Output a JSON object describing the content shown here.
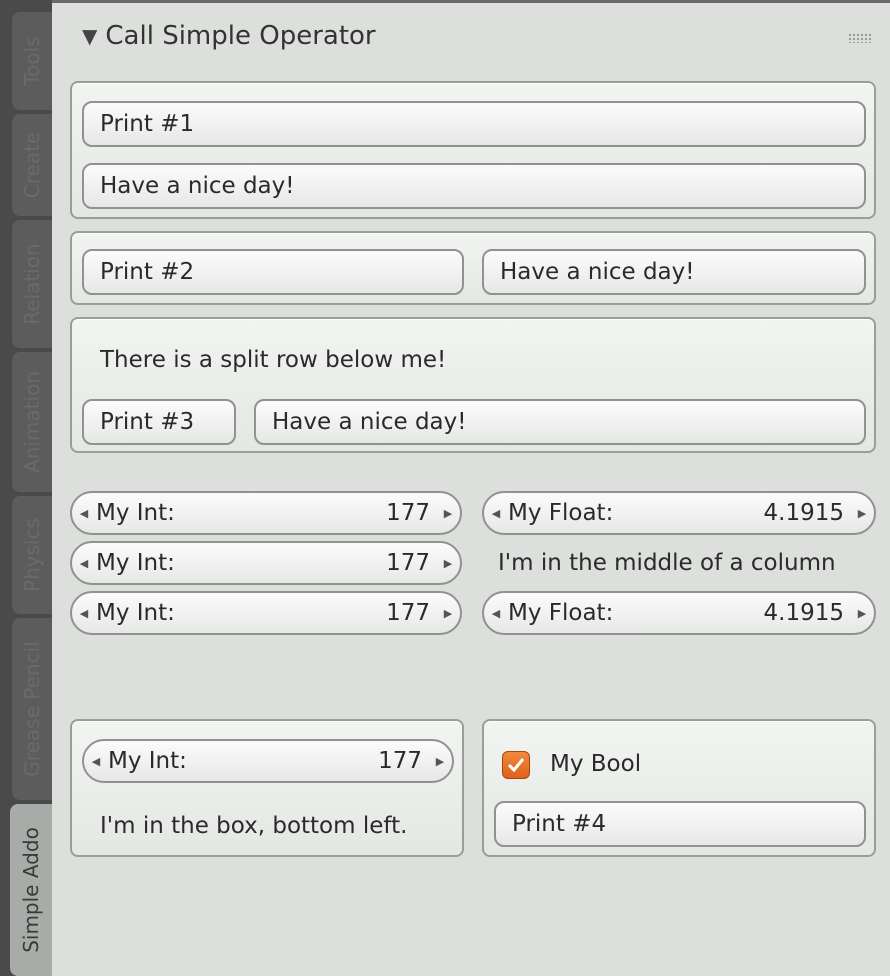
{
  "tabs": [
    "Tools",
    "Create",
    "Relation",
    "Animation",
    "Physics",
    "Grease Pencil",
    "Simple Addo"
  ],
  "panel": {
    "title": "Call Simple Operator"
  },
  "box1": {
    "button": "Print #1",
    "field": "Have a nice day!"
  },
  "box2": {
    "button": "Print #2",
    "field": "Have a nice day!"
  },
  "box3": {
    "note": "There is a split row below me!",
    "button": "Print #3",
    "field": "Have a nice day!"
  },
  "columns": {
    "left": [
      {
        "label": "My Int:",
        "value": "177"
      },
      {
        "label": "My Int:",
        "value": "177"
      },
      {
        "label": "My Int:",
        "value": "177"
      }
    ],
    "right_top": {
      "label": "My Float:",
      "value": "4.1915"
    },
    "right_middle_text": "I'm in the middle of a column",
    "right_bottom": {
      "label": "My Float:",
      "value": "4.1915"
    }
  },
  "bottom_left": {
    "label": "My Int:",
    "value": "177",
    "note": "I'm in the box, bottom left."
  },
  "bottom_right": {
    "bool_label": "My Bool",
    "bool_checked": true,
    "button": "Print #4"
  },
  "colors": {
    "accent": "#e8702a",
    "background": "#dcdfdc",
    "tab_strip": "#4a4a4a"
  }
}
